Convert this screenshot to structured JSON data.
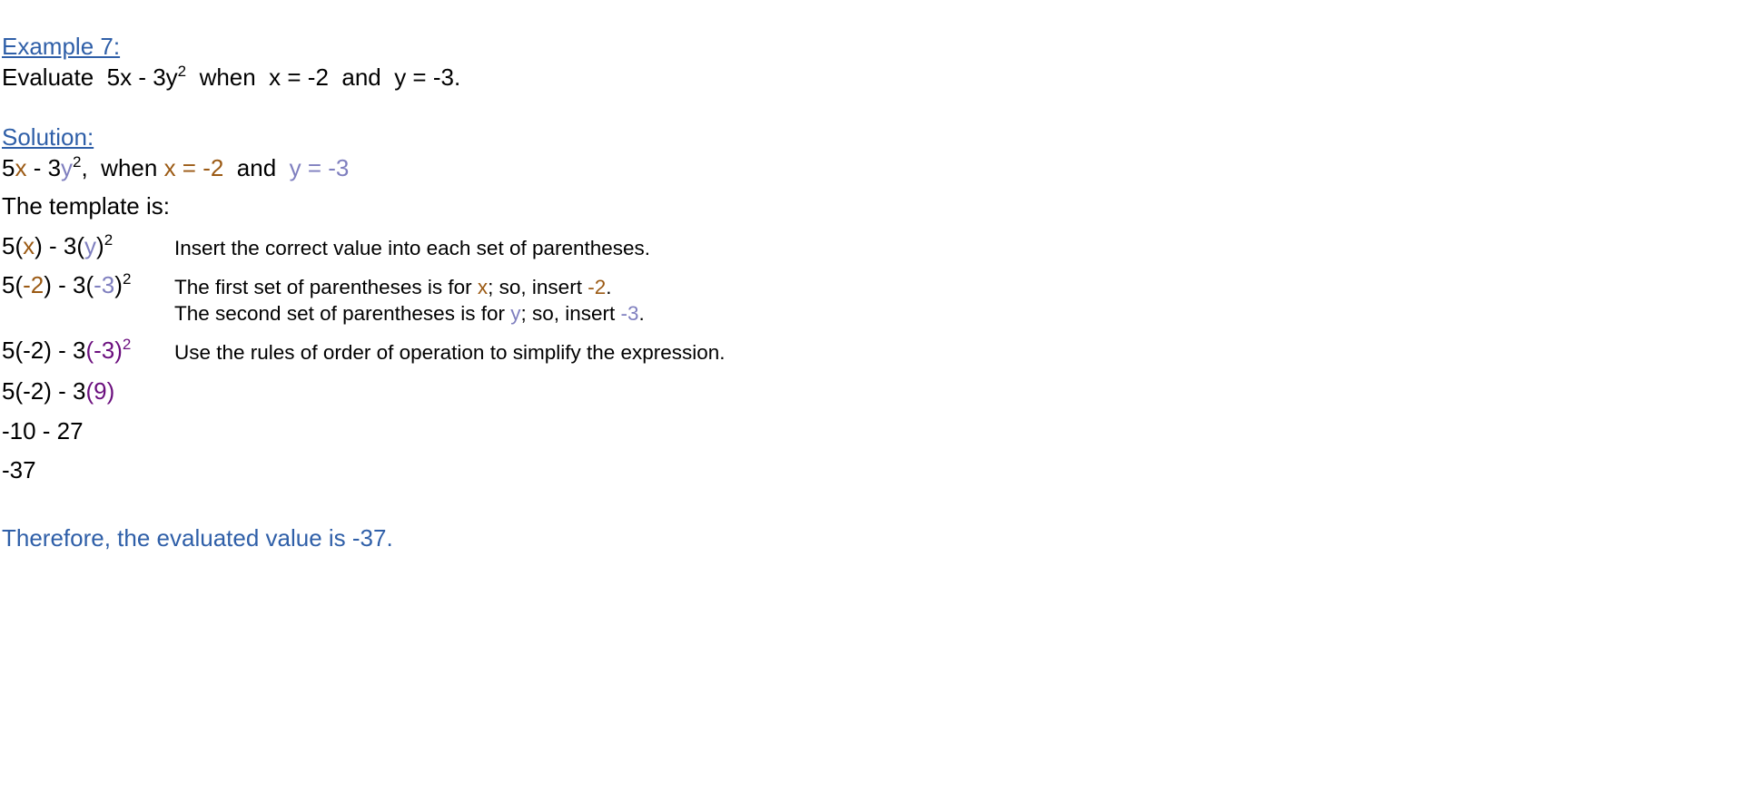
{
  "example": {
    "heading": "Example 7:",
    "prompt_pre": "Evaluate  5x - 3y",
    "prompt_exp": "2",
    "prompt_post": "  when  x = -2  and  y = -3."
  },
  "solution": {
    "heading": "Solution:",
    "given": {
      "p1": "5",
      "x": "x",
      "p2": " - 3",
      "y": "y",
      "exp": "2",
      "p3": ",  when ",
      "xval": "x = -2",
      "p4": "  and  ",
      "yval": "y = -3"
    },
    "template_label": "The template is:",
    "step1": {
      "a": "5(",
      "x": "x",
      "b": ") - 3(",
      "y": "y",
      "c": ")",
      "exp": "2",
      "note": "Insert the correct value into each set of parentheses."
    },
    "step2": {
      "a": "5(",
      "x": "-2",
      "b": ") - 3(",
      "y": "-3",
      "c": ")",
      "exp": "2",
      "note1_pre": "The first set of parentheses is for ",
      "note1_var": "x",
      "note1_mid": "; so, insert ",
      "note1_val": "-2",
      "note1_end": ".",
      "note2_pre": "The second set of parentheses is for ",
      "note2_var": "y",
      "note2_mid": "; so, insert ",
      "note2_val": "-3",
      "note2_end": "."
    },
    "step3": {
      "a": "5(-2) - 3",
      "hl": "(-3)",
      "exp": "2",
      "note": "Use the rules of order of operation to simplify the expression."
    },
    "step4": {
      "a": "5(-2) - 3",
      "hl": "(9)"
    },
    "step5": "-10 - 27",
    "step6": "-37",
    "conclusion": "Therefore, the evaluated value is -37."
  },
  "colors": {
    "heading": "#2f5fa8",
    "x_variable": "#9b5a14",
    "y_variable": "#7f7fbf",
    "highlight": "#6b0f7e"
  }
}
